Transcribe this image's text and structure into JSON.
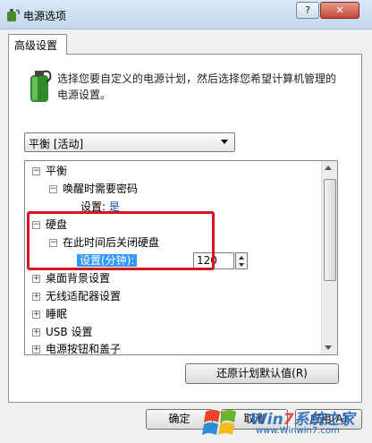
{
  "window": {
    "title": "电源选项",
    "help_label": "?",
    "close_label": "✕"
  },
  "tab": {
    "label": "高级设置"
  },
  "description": "选择您要自定义的电源计划，然后选择您希望计算机管理的电源设置。",
  "plan_select": {
    "value": "平衡 [活动]"
  },
  "tree": {
    "balanced": "平衡",
    "password_on_wake": "唤醒时需要密码",
    "password_setting_label": "设置:",
    "password_setting_value": "是",
    "hard_disk": "硬盘",
    "turn_off_hd": "在此时间后关闭硬盘",
    "minutes_label": "设置(分钟):",
    "minutes_value": "120",
    "desktop_bg": "桌面背景设置",
    "wireless": "无线适配器设置",
    "sleep": "睡眠",
    "usb": "USB 设置",
    "power_buttons": "电源按钮和盖子"
  },
  "buttons": {
    "restore": "还原计划默认值(R)",
    "ok": "确定",
    "cancel": "取消",
    "apply": "应用(A)"
  },
  "watermark": {
    "part1": "Win",
    "part2": "7",
    "part3": "系统之家",
    "url": "www.Winwin7.com"
  },
  "colors": {
    "highlight_border": "#d8141e",
    "selection": "#3399ff"
  }
}
